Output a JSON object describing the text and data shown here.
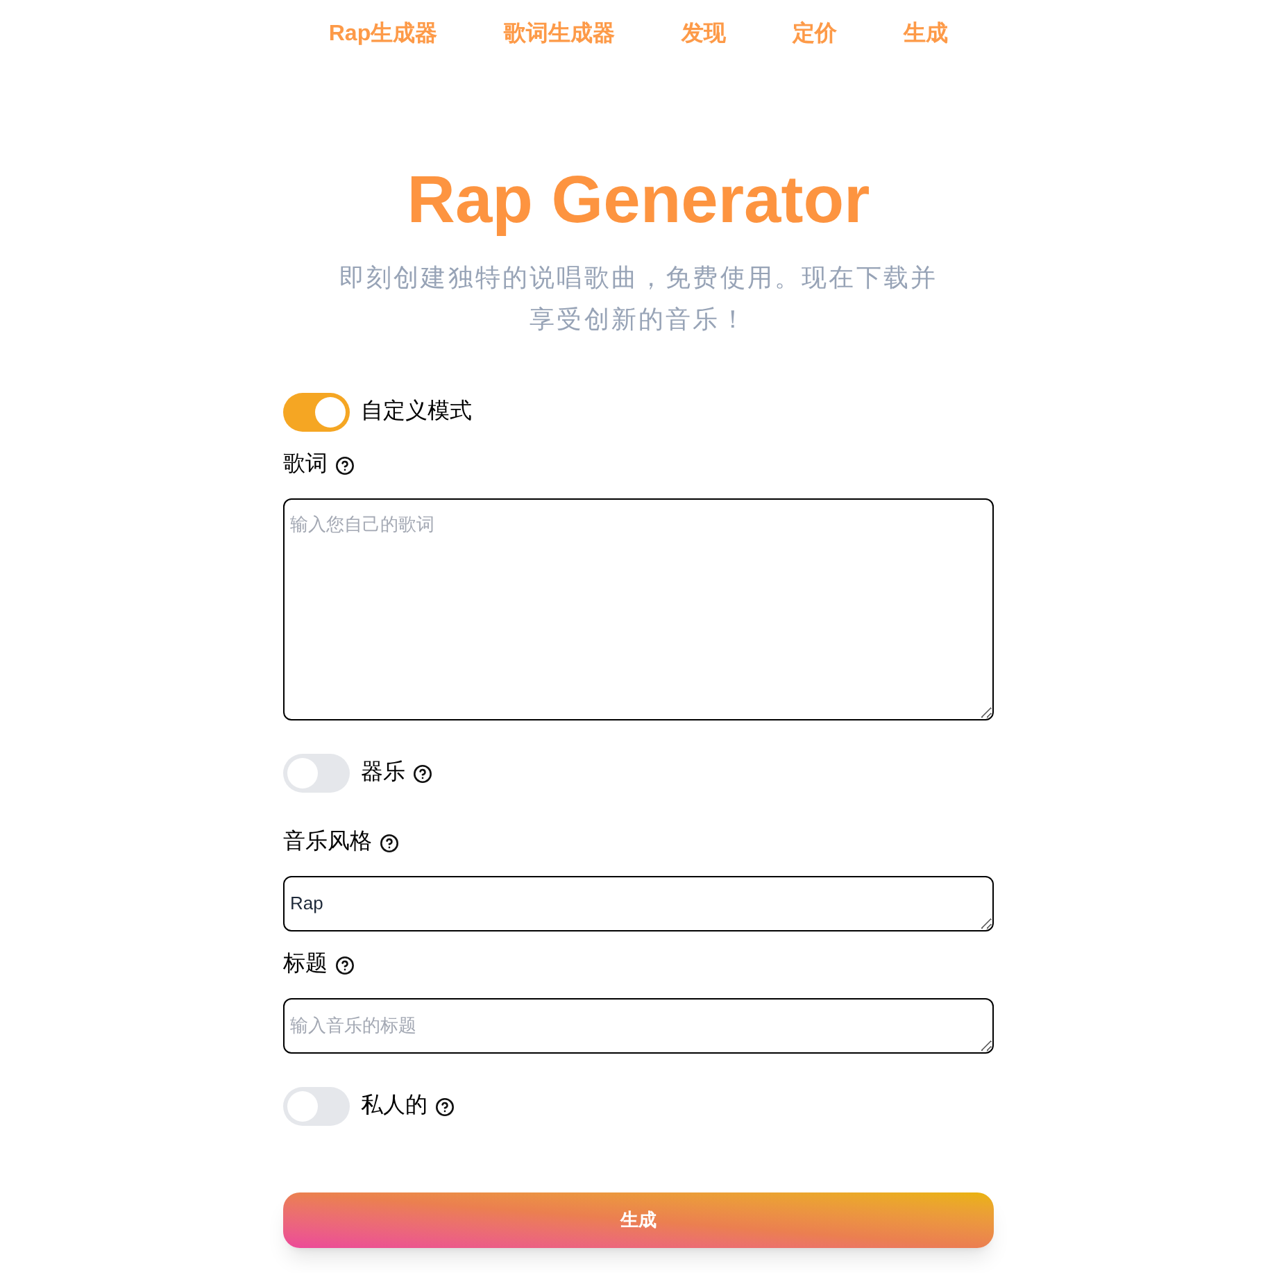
{
  "nav": {
    "items": [
      {
        "label": "Rap生成器"
      },
      {
        "label": "歌词生成器"
      },
      {
        "label": "发现"
      },
      {
        "label": "定价"
      },
      {
        "label": "生成"
      }
    ]
  },
  "hero": {
    "title": "Rap Generator",
    "subtitle": "即刻创建独特的说唱歌曲，免费使用。现在下载并享受创新的音乐！"
  },
  "form": {
    "fields": [
      {
        "kind": "toggle",
        "label": "自定义模式",
        "on": true,
        "help": false
      },
      {
        "kind": "textarea",
        "label": "歌词",
        "help": true,
        "placeholder": "输入您自己的歌词"
      },
      {
        "kind": "toggle",
        "label": "器乐",
        "on": false,
        "help": true
      },
      {
        "kind": "input",
        "label": "音乐风格",
        "help": true,
        "value": "Rap"
      },
      {
        "kind": "input",
        "label": "标题",
        "help": true,
        "placeholder": "输入音乐的标题"
      },
      {
        "kind": "toggle",
        "label": "私人的",
        "on": false,
        "help": true
      }
    ]
  },
  "submit": {
    "label": "生成"
  }
}
